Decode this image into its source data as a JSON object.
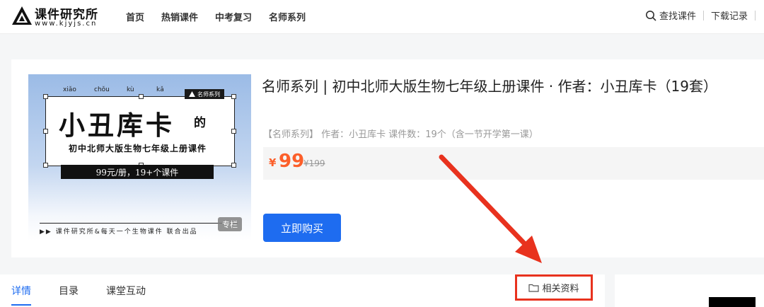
{
  "header": {
    "logo_title": "课件研究所",
    "logo_url": "www.kjyjs.cn",
    "nav": [
      "首页",
      "热销课件",
      "中考复习",
      "名师系列"
    ],
    "search_label": "查找课件",
    "downloads_label": "下载记录"
  },
  "cover": {
    "pinyin": [
      "xiǎo",
      "chǒu",
      "kù",
      "kǎ"
    ],
    "big_title": "小丑库卡",
    "de": "的",
    "badge": "名师系列",
    "subtitle": "初中北师大版生物七年级上册课件",
    "price_line": "99元/册，19+个课件",
    "footer": "▶▶ 课件研究所&每天一个生物课件   联合出品",
    "tag": "专栏"
  },
  "product": {
    "title": "名师系列 | 初中北师大版生物七年级上册课件 · 作者：小丑库卡（19套）",
    "meta": "【名师系列】 作者：小丑库卡  课件数：19个（含一节开学第一课）",
    "currency": "¥",
    "price": "99",
    "original_price": "¥199",
    "buy_label": "立即购买"
  },
  "tabs": {
    "items": [
      "详情",
      "目录",
      "课堂互动"
    ],
    "related_label": "相关资料"
  },
  "colors": {
    "accent": "#1e6cf0",
    "price": "#fc5f2a",
    "annotation": "#e8321e"
  }
}
